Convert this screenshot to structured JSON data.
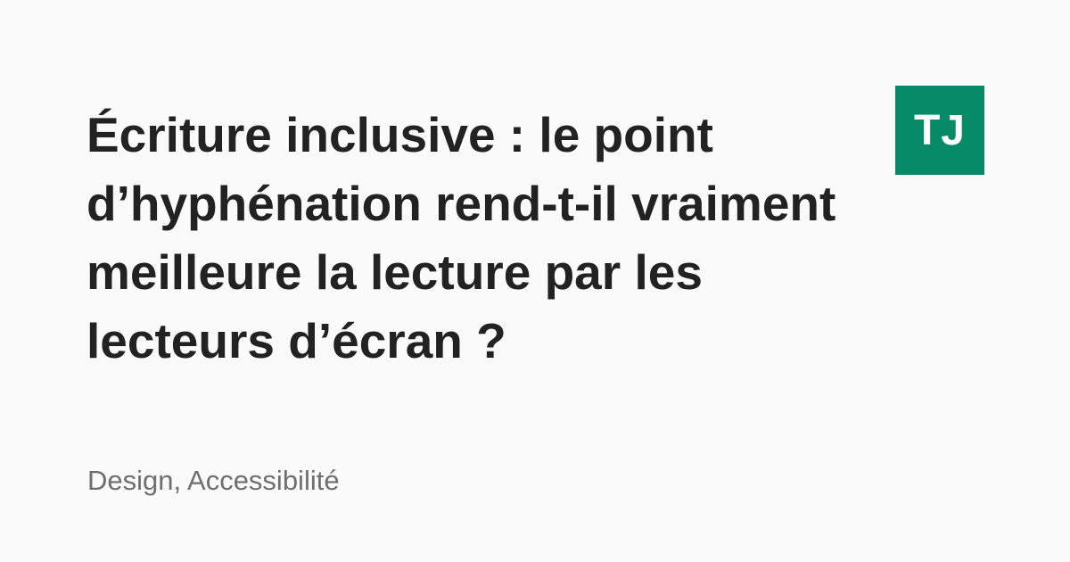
{
  "article": {
    "title": "Écriture inclusive : le point d’hyphénation rend-t-il vraiment meilleure la lecture par les lecteurs d’écran ?",
    "tags": "Design, Accessibilité"
  },
  "logo": {
    "text": "TJ",
    "color": "#078a68"
  }
}
